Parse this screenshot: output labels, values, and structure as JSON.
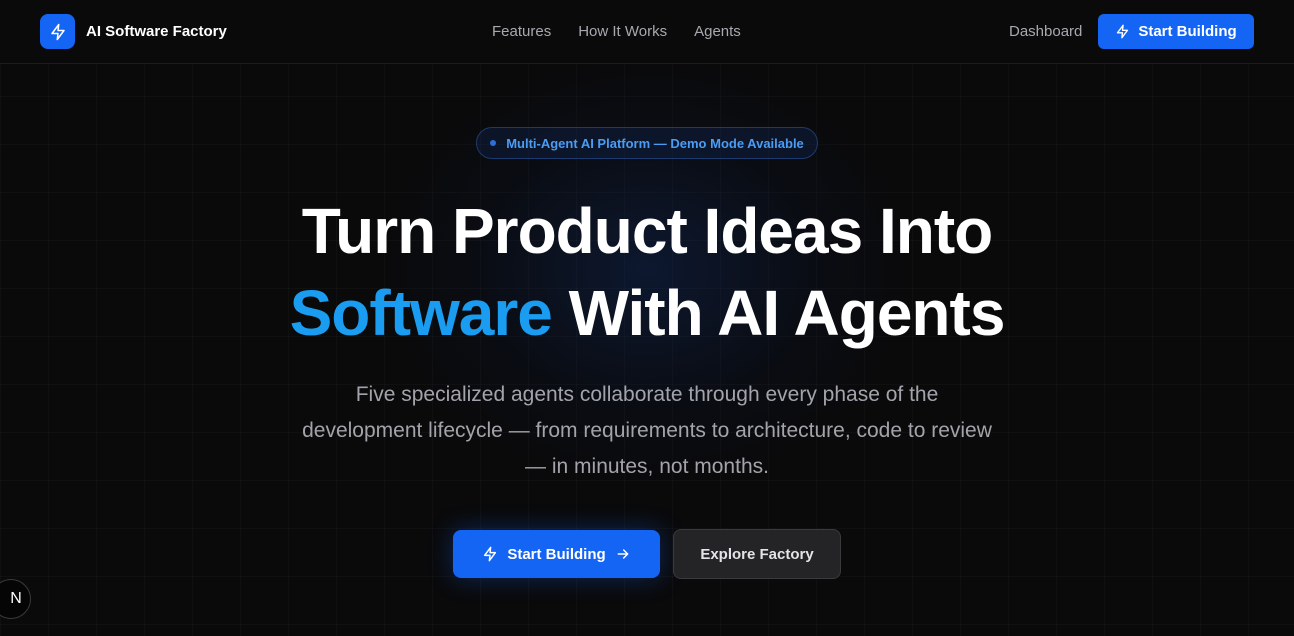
{
  "colors": {
    "background": "#0a0a0b",
    "accent_blue": "#1565f5",
    "accent_text": "#1a9cf0",
    "muted_text": "#a3a3ab"
  },
  "navbar": {
    "brand_icon": "lightning-bolt-icon",
    "brand_name": "AI Software Factory",
    "links": [
      "Features",
      "How It Works",
      "Agents"
    ],
    "dashboard_label": "Dashboard",
    "cta_icon": "lightning-bolt-icon",
    "cta_label": "Start Building"
  },
  "badge": {
    "text": "Multi-Agent AI Platform — Demo Mode Available"
  },
  "hero": {
    "title_line1": "Turn Product Ideas Into",
    "title_accent": "Software",
    "title_line2_rest": " With AI Agents",
    "subtitle": "Five specialized agents collaborate through every phase of the development lifecycle — from requirements to architecture, code to review — in minutes, not months."
  },
  "actions": {
    "primary_icon": "lightning-bolt-icon",
    "primary_label": "Start Building",
    "primary_trailing_icon": "arrow-right-icon",
    "secondary_label": "Explore Factory"
  },
  "dev_indicator": {
    "label": "N"
  }
}
